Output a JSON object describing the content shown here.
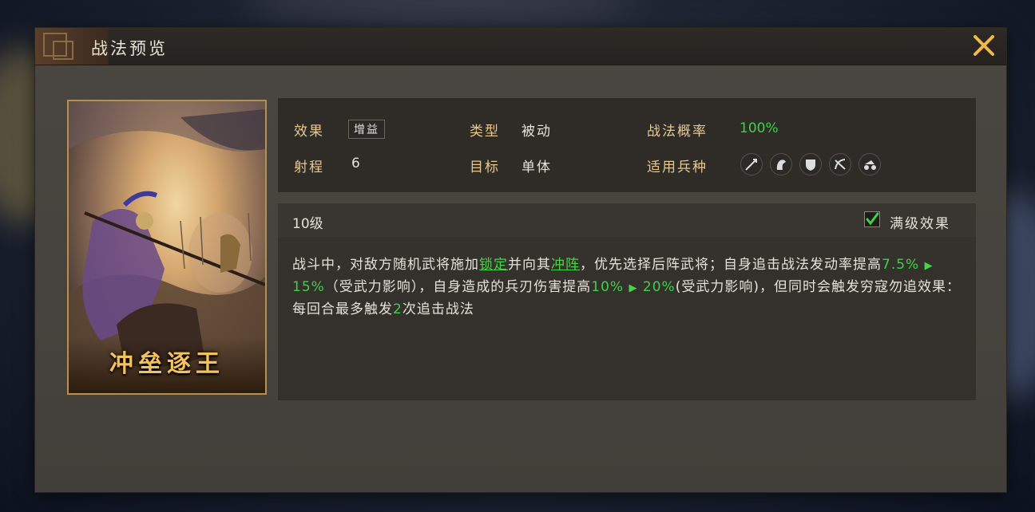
{
  "window": {
    "title": "战法预览",
    "close_icon": "close-x-icon"
  },
  "card": {
    "name": "冲垒逐王"
  },
  "info": {
    "effect_label": "效果",
    "effect_value": "增益",
    "type_label": "类型",
    "type_value": "被动",
    "prob_label": "战法概率",
    "prob_value": "100%",
    "range_label": "射程",
    "range_value": "6",
    "target_label": "目标",
    "target_value": "单体",
    "troops_label": "适用兵种",
    "troop_icons": [
      "spear-icon",
      "horse-icon",
      "shield-icon",
      "bow-icon",
      "siege-icon"
    ]
  },
  "detail": {
    "level": "10级",
    "max_checkbox_checked": true,
    "max_label": "满级效果",
    "desc": {
      "p1": "战斗中，对敌方随机武将施加",
      "kw1": "锁定",
      "p2": "并向其",
      "kw2": "冲阵",
      "p3": "，优先选择后阵武将；自身追击战法发动率提高",
      "v1": "7.5%",
      "v2": "15%",
      "p4": "（受武力影响），自身造成的兵刃伤害提高",
      "v3": "10%",
      "v4": "20%",
      "p5": "(受武力影响)，但同时会触发穷寇勿追效果：每回合最多触发",
      "v5": "2",
      "p6": "次追击战法"
    }
  },
  "colors": {
    "accent_green": "#3fd04a",
    "label_gold": "#e6c98c",
    "card_name": "#f4c15a"
  }
}
